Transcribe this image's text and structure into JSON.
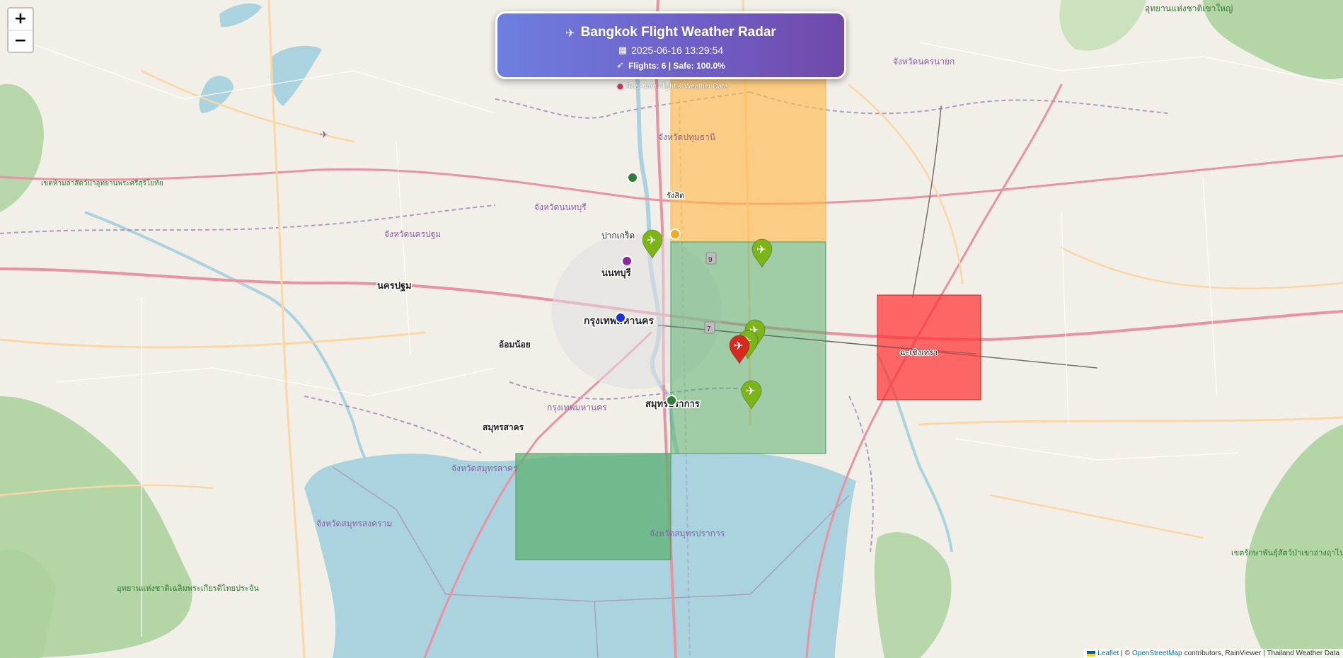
{
  "header": {
    "title": "Bangkok Flight Weather Radar",
    "datetime": "2025-06-16 13:29:54",
    "stats": "Flights: 6 | Safe: 100.0%",
    "tagline": "Real-time Flight & Weather Data"
  },
  "zoom": {
    "in_label": "+",
    "out_label": "−"
  },
  "attribution": {
    "leaflet": "Leaflet",
    "separator": "| ©",
    "osm": "OpenStreetMap",
    "rest": "contributors, RainViewer | Thailand Weather Data"
  },
  "colors": {
    "zone_safe": "#5cae6f",
    "zone_caution": "#ffb84d",
    "zone_danger": "#ff3030",
    "flight_marker": "#7cb518",
    "flight_marker_alert": "#d62a1e",
    "water": "#aad3df"
  },
  "flights": [
    {
      "status": "safe"
    },
    {
      "status": "safe"
    },
    {
      "status": "safe"
    },
    {
      "status": "safe"
    },
    {
      "status": "alert"
    },
    {
      "status": "safe"
    }
  ],
  "weather_stations": [
    {
      "color": "#2e7d32"
    },
    {
      "color": "#f5a623"
    },
    {
      "color": "#8e24aa"
    },
    {
      "color": "#1a2fe0"
    },
    {
      "color": "#2e7d32"
    }
  ],
  "map_labels": {
    "bangkok": "กรุงเทพมหานคร",
    "nonthaburi": "นนทบุรี",
    "pakkret": "ปากเกร็ด",
    "samutprakan": "สมุทรปราการ",
    "samutsakhon": "สมุทรสาคร",
    "omnoi": "อ้อมน้อย",
    "nakhonpathom": "นครปฐม",
    "rangsit": "รังสิต",
    "chachoengsao": "ฉะเชิงเทรา",
    "prov_samutprakan": "จังหวัดสมุทรปราการ",
    "prov_samutsakhon": "จังหวัดสมุทรสาคร",
    "prov_samutsongkhram": "จังหวัดสมุทรสงคราม",
    "prov_pathumthani": "จังหวัดปทุมธานี",
    "prov_nonthaburi": "จังหวัดนนทบุรี",
    "prov_nakhonpathom": "จังหวัดนครปฐม",
    "prov_nakhonnayok": "จังหวัดนครนายก",
    "prov_bangkok": "กรุงเทพมหานคร",
    "park_khaoyai": "อุทยานแห่งชาติเขาใหญ่",
    "park_phanthusawat": "เขตรักษาพันธุ์สัตว์ป่าเขาอ่างฤาไน",
    "park_kaengkrachan": "อุทยานแห่งชาติเฉลิมพระเกียรติไทยประจัน",
    "park_bangkrachao": "เขตห้ามล่าสัตว์ป่าอุทยานพระศรีสุริโยทัย"
  }
}
